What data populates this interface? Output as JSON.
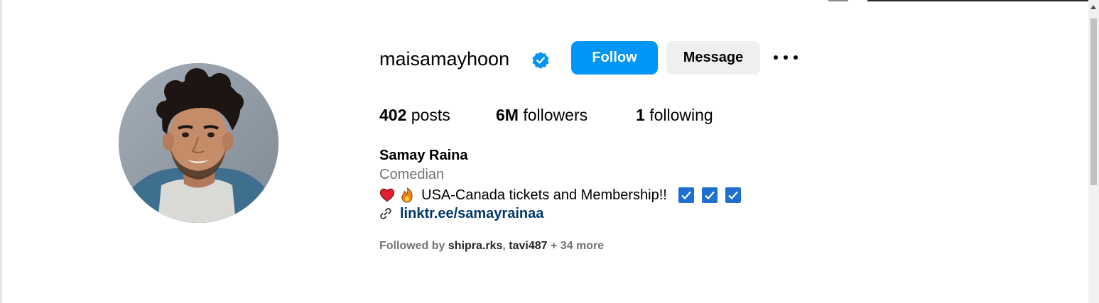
{
  "profile": {
    "username": "maisamayhoon",
    "verified_icon": "verified-badge-icon",
    "follow_label": "Follow",
    "message_label": "Message",
    "more_icon": "more-options-icon"
  },
  "stats": {
    "posts_count": "402",
    "posts_label": "posts",
    "followers_count": "6M",
    "followers_label": "followers",
    "following_count": "1",
    "following_label": "following"
  },
  "bio": {
    "full_name": "Samay Raina",
    "category": "Comedian",
    "text": "USA-Canada tickets and Membership!!",
    "leading_emojis": [
      "heart-emoji",
      "fire-emoji"
    ],
    "trailing_emojis": [
      "check-box-emoji",
      "check-box-emoji",
      "check-box-emoji"
    ],
    "link_icon": "link-icon",
    "link": "linktr.ee/samayrainaa"
  },
  "followed_by": {
    "prefix": "Followed by",
    "user1": "shipra.rks",
    "separator": ",",
    "user2": "tavi487",
    "suffix": "+ 34 more"
  },
  "colors": {
    "follow_button": "#0095f6",
    "message_button": "#efefef",
    "verified_badge": "#0095f6",
    "link": "#00376b",
    "secondary_text": "#737373"
  }
}
